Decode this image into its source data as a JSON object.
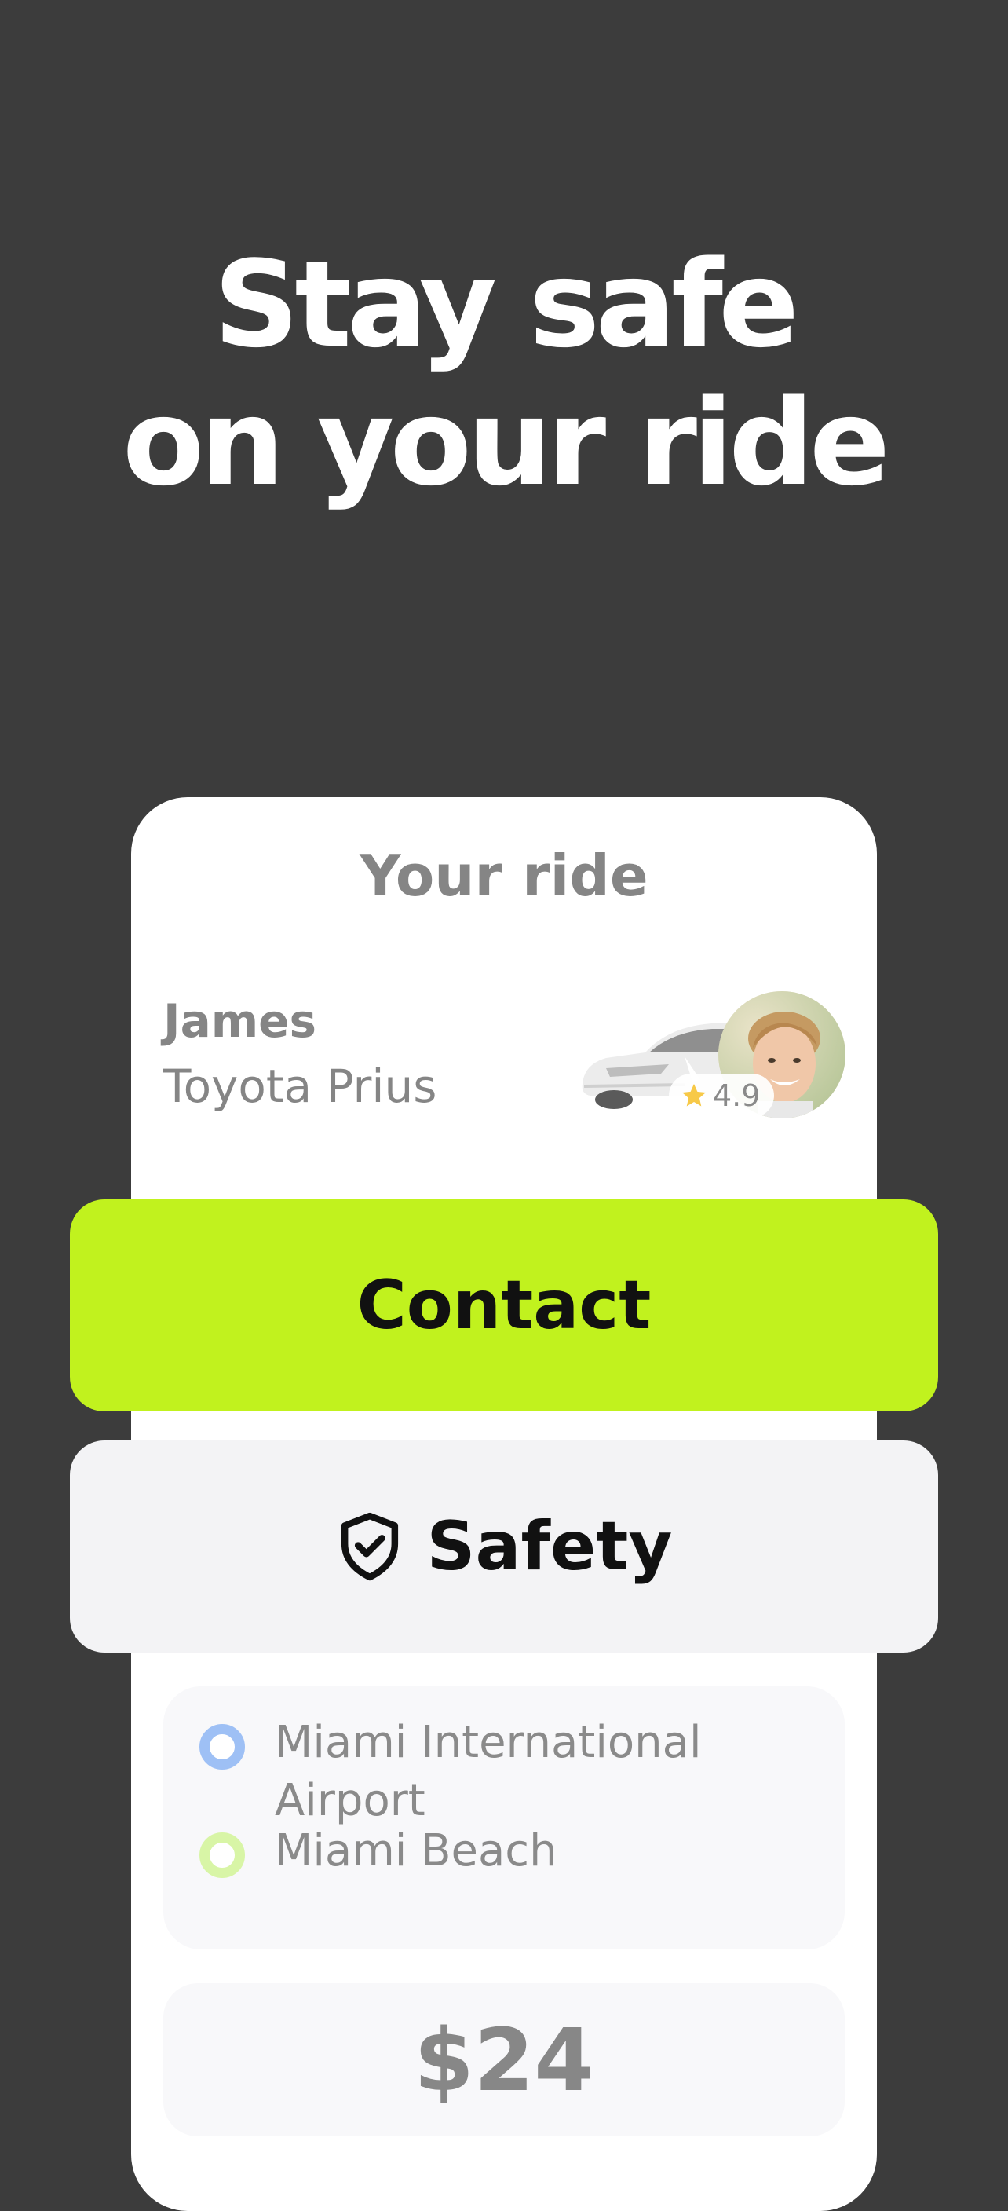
{
  "headline": {
    "line1": "Stay safe",
    "line2": "on your ride"
  },
  "ride_card": {
    "title": "Your ride",
    "driver_name": "James",
    "car_model": "Toyota Prius",
    "rating": "4.9"
  },
  "buttons": {
    "contact_label": "Contact",
    "safety_label": "Safety"
  },
  "route": {
    "pickup": "Miami International Airport",
    "dropoff": "Miami Beach"
  },
  "price": "$24",
  "colors": {
    "background": "#3c3c3c",
    "accent": "#c1f21e",
    "pickup_dot": "#9ec0f5",
    "dropoff_dot": "#d8f5a6",
    "star": "#f7c948"
  },
  "icons": {
    "safety": "shield-check-icon",
    "rating": "star-icon"
  }
}
